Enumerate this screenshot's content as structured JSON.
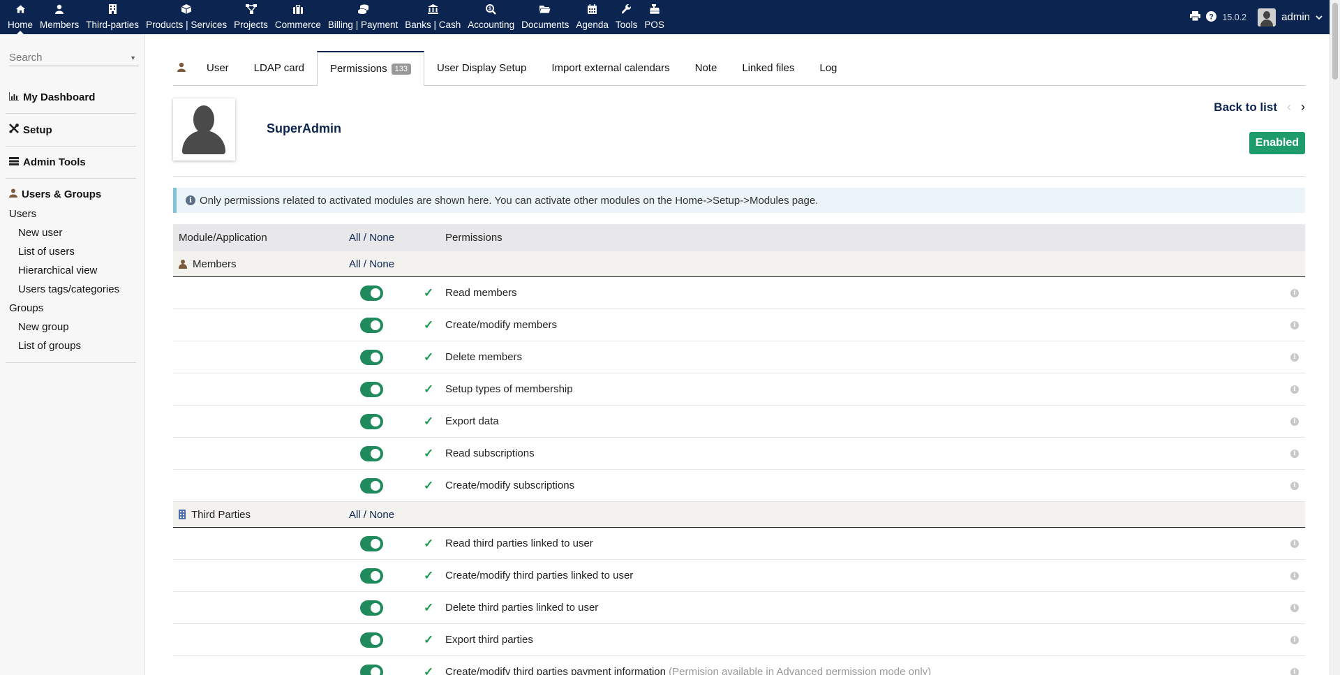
{
  "topnav": [
    {
      "label": "Home",
      "icon": "home-icon",
      "active": true
    },
    {
      "label": "Members",
      "icon": "member-icon"
    },
    {
      "label": "Third-parties",
      "icon": "building-icon"
    },
    {
      "label": "Products | Services",
      "icon": "cube-icon"
    },
    {
      "label": "Projects",
      "icon": "project-icon"
    },
    {
      "label": "Commerce",
      "icon": "suitcase-icon"
    },
    {
      "label": "Billing | Payment",
      "icon": "coins-icon"
    },
    {
      "label": "Banks | Cash",
      "icon": "bank-icon"
    },
    {
      "label": "Accounting",
      "icon": "search-dollar-icon"
    },
    {
      "label": "Documents",
      "icon": "folder-icon"
    },
    {
      "label": "Agenda",
      "icon": "calendar-icon"
    },
    {
      "label": "Tools",
      "icon": "wrench-icon"
    },
    {
      "label": "POS",
      "icon": "cash-register-icon"
    }
  ],
  "topright": {
    "version": "15.0.2",
    "user": "admin"
  },
  "sidebar": {
    "search_placeholder": "Search",
    "sections": [
      "My Dashboard",
      "Setup",
      "Admin Tools"
    ],
    "group_title": "Users & Groups",
    "users_label": "Users",
    "users_items": [
      "New user",
      "List of users",
      "Hierarchical view",
      "Users tags/categories"
    ],
    "groups_label": "Groups",
    "groups_items": [
      "New group",
      "List of groups"
    ]
  },
  "tabs": [
    {
      "label": "User"
    },
    {
      "label": "LDAP card"
    },
    {
      "label": "Permissions",
      "badge": "133",
      "active": true
    },
    {
      "label": "User Display Setup"
    },
    {
      "label": "Import external calendars"
    },
    {
      "label": "Note"
    },
    {
      "label": "Linked files"
    },
    {
      "label": "Log"
    }
  ],
  "header": {
    "name": "SuperAdmin",
    "back": "Back to list",
    "status": "Enabled"
  },
  "info": "Only permissions related to activated modules are shown here. You can activate other modules on the Home->Setup->Modules page.",
  "table": {
    "col_module": "Module/Application",
    "col_allnone_all": "All",
    "col_allnone_sep": " / ",
    "col_allnone_none": "None",
    "col_permissions": "Permissions",
    "modules": [
      {
        "name": "Members",
        "icon": "member-icon",
        "perms": [
          {
            "label": "Read members",
            "enabled": true
          },
          {
            "label": "Create/modify members",
            "enabled": true
          },
          {
            "label": "Delete members",
            "enabled": true
          },
          {
            "label": "Setup types of membership",
            "enabled": true
          },
          {
            "label": "Export data",
            "enabled": true
          },
          {
            "label": "Read subscriptions",
            "enabled": true
          },
          {
            "label": "Create/modify subscriptions",
            "enabled": true
          }
        ]
      },
      {
        "name": "Third Parties",
        "icon": "building-icon",
        "perms": [
          {
            "label": "Read third parties linked to user",
            "enabled": true
          },
          {
            "label": "Create/modify third parties linked to user",
            "enabled": true
          },
          {
            "label": "Delete third parties linked to user",
            "enabled": true
          },
          {
            "label": "Export third parties",
            "enabled": true
          },
          {
            "label": "Create/modify third parties payment information",
            "note": "(Permision available in Advanced permission mode only)",
            "enabled": true
          }
        ]
      }
    ]
  }
}
